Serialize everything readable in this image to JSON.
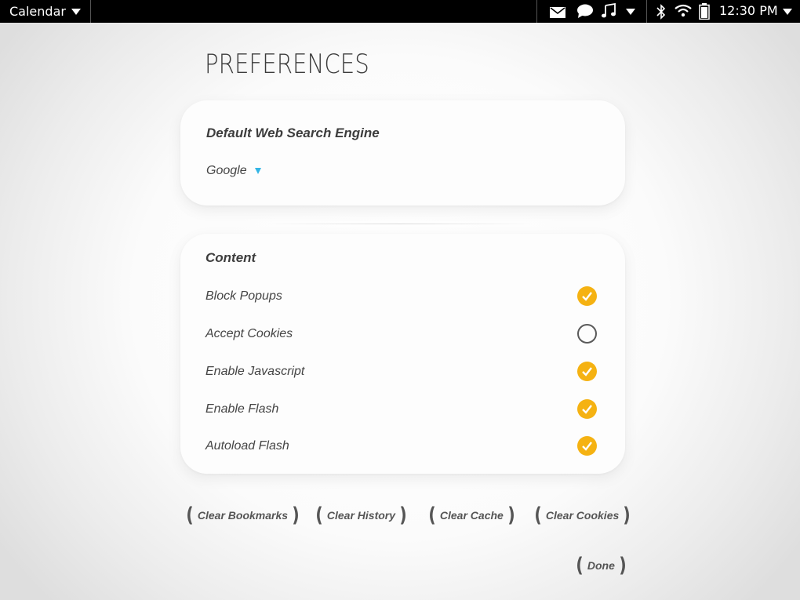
{
  "status_bar": {
    "app_menu_label": "Calendar",
    "clock": "12:30 PM",
    "icons": [
      "mail-icon",
      "chat-icon",
      "music-icon",
      "bluetooth-icon",
      "wifi-icon",
      "battery-icon"
    ]
  },
  "page": {
    "title": "PREFERENCES"
  },
  "search": {
    "heading": "Default Web Search Engine",
    "selected": "Google"
  },
  "content": {
    "heading": "Content",
    "items": [
      {
        "label": "Block Popups",
        "checked": true
      },
      {
        "label": "Accept Cookies",
        "checked": false
      },
      {
        "label": "Enable Javascript",
        "checked": true
      },
      {
        "label": "Enable Flash",
        "checked": true
      },
      {
        "label": "Autoload Flash",
        "checked": true
      }
    ]
  },
  "actions": {
    "clear_bookmarks": "Clear Bookmarks",
    "clear_history": "Clear History",
    "clear_cache": "Clear Cache",
    "clear_cookies": "Clear Cookies",
    "done": "Done"
  },
  "colors": {
    "accent_check": "#f5b212",
    "caret": "#33b5e5",
    "status_bar": "#000000"
  }
}
